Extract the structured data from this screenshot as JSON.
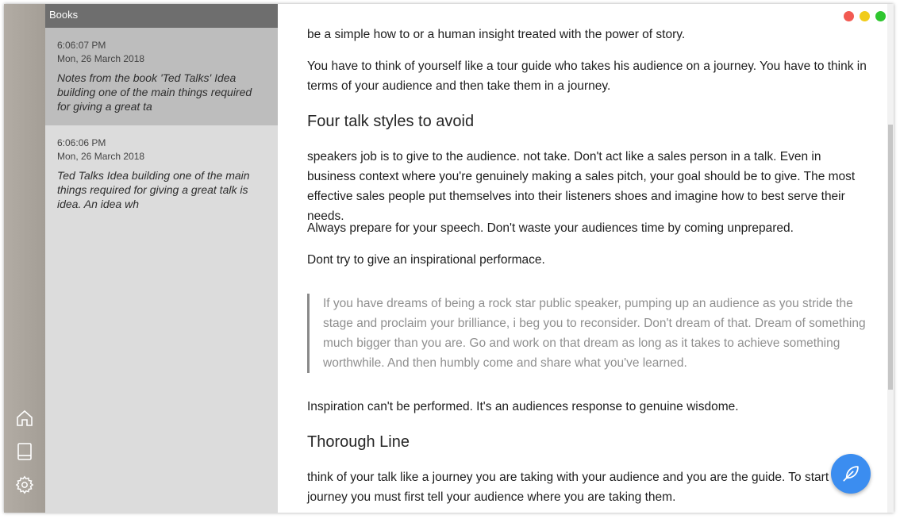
{
  "sidebar": {
    "header": "Books",
    "notes": [
      {
        "time": "6:06:07 PM",
        "date": "Mon, 26 March 2018",
        "preview": "Notes from the book 'Ted Talks' Idea building one of the main things required for giving  a great ta"
      },
      {
        "time": "6:06:06 PM",
        "date": "Mon, 26 March 2018",
        "preview": "Ted Talks Idea building one of the main things required for giving  a great talk is idea. An idea wh"
      }
    ]
  },
  "rail": {
    "icons": [
      "home-icon",
      "book-icon",
      "gear-icon"
    ]
  },
  "window_controls": {
    "colors": [
      "#f25a52",
      "#f1cc1a",
      "#2fc62f"
    ]
  },
  "fab": {
    "icon": "feather-pen-icon",
    "color": "#3b8df0"
  },
  "document": {
    "p0": "be a simple how to or a human insight treated with the power of story.",
    "p1": "You have to think of yourself like a tour guide who takes his audience on a journey. You have to think in terms of your audience and then take them in a journey.",
    "h1": "Four talk styles to avoid",
    "p2": "speakers job is to give to the audience. not take. Don't act like a sales person in a talk. Even in business context where you're genuinely making a sales pitch, your goal should be to give. The most effective sales people put themselves into their listeners shoes and imagine how to best serve their needs.",
    "p3": "Always prepare for your speech. Don't waste your audiences time by coming unprepared.",
    "p4": " Dont try to give an inspirational performace.",
    "quote": "If you have dreams of being a rock star public speaker, pumping up an audience as you stride the stage and proclaim your brilliance, i beg you to reconsider. Don't dream of that. Dream of something much bigger than you are. Go and work on that dream as long as it takes to achieve something worthwhile. And then humbly come and share what you've learned.",
    "p5": "Inspiration can't be performed.  It's an audiences response to genuine wisdome.",
    "h2": "Thorough Line",
    "p6": "think of your talk like a journey you are taking with your audience and you are the guide. To start a journey you must first tell your audience where you are taking them."
  }
}
